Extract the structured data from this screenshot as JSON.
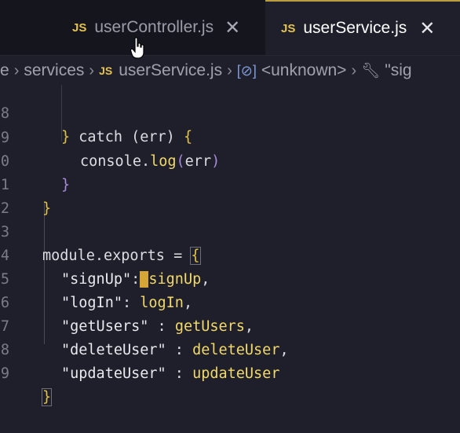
{
  "tabs": [
    {
      "label": "userController.js",
      "lang": "JS",
      "close": "✕",
      "active": false
    },
    {
      "label": "userService.js",
      "lang": "JS",
      "close": "✕",
      "active": true
    }
  ],
  "breadcrumb": {
    "lead": "e",
    "folder": "services",
    "file_lang": "JS",
    "file": "userService.js",
    "symbol_icon": "[⊘]",
    "symbol": "<unknown>",
    "wrench_icon": "wrench-icon",
    "last": "\"sig"
  },
  "code": {
    "lines": [
      {
        "number": "8",
        "text": "} catch (err) {"
      },
      {
        "number": "9",
        "text": "console.log(err)"
      },
      {
        "number": "0",
        "text": "}"
      },
      {
        "number": "1",
        "text": "}"
      },
      {
        "number": "2",
        "text": ""
      },
      {
        "number": "3",
        "text": "module.exports = {"
      },
      {
        "number": "4",
        "text": "\"signUp\": signUp,"
      },
      {
        "number": "5",
        "text": "\"logIn\": logIn,"
      },
      {
        "number": "6",
        "text": "\"getUsers\" : getUsers,"
      },
      {
        "number": "7",
        "text": "\"deleteUser\" : deleteUser,"
      },
      {
        "number": "8",
        "text": "\"updateUser\" : updateUser"
      },
      {
        "number": "9",
        "text": "}"
      }
    ]
  },
  "colors": {
    "background": "#1f1f2b",
    "tab_bar": "#15161d",
    "accent": "#e6c24e",
    "brace": "#e0c14a",
    "paren": "#a78bd8",
    "cursor_highlight": "#d5a535"
  }
}
